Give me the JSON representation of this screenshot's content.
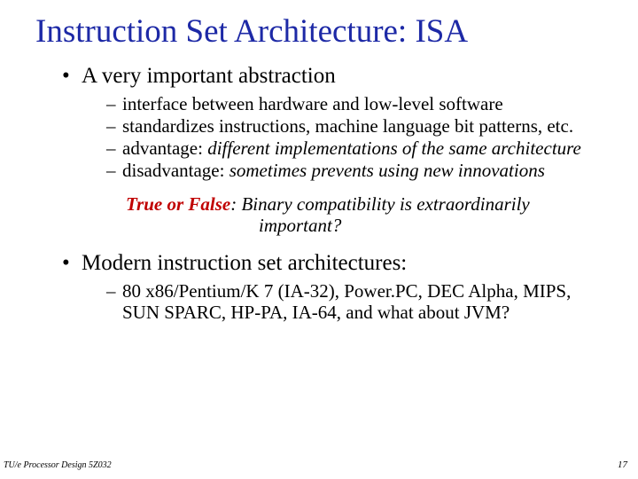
{
  "title": "Instruction Set Architecture: ISA",
  "bullet1": {
    "text": "A very important abstraction",
    "subs": {
      "s1": "interface between hardware and low-level software",
      "s2": "standardizes instructions, machine language bit patterns, etc.",
      "s3a": "advantage:  ",
      "s3b": "different implementations of the same architecture",
      "s4a": "disadvantage:  ",
      "s4b": "sometimes prevents using new innovations"
    }
  },
  "question": {
    "tf": "True or False",
    "colon": ":  ",
    "line1": "Binary compatibility is extraordinarily",
    "line2": "important?"
  },
  "bullet2": {
    "text": "Modern instruction set architectures:",
    "subs": {
      "s1": "80 x86/Pentium/K 7 (IA-32),  Power.PC,  DEC Alpha,  MIPS, SUN SPARC, HP-PA, IA-64, and what about JVM?"
    }
  },
  "footer": {
    "left": "TU/e  Processor Design 5Z032",
    "right": "17"
  }
}
